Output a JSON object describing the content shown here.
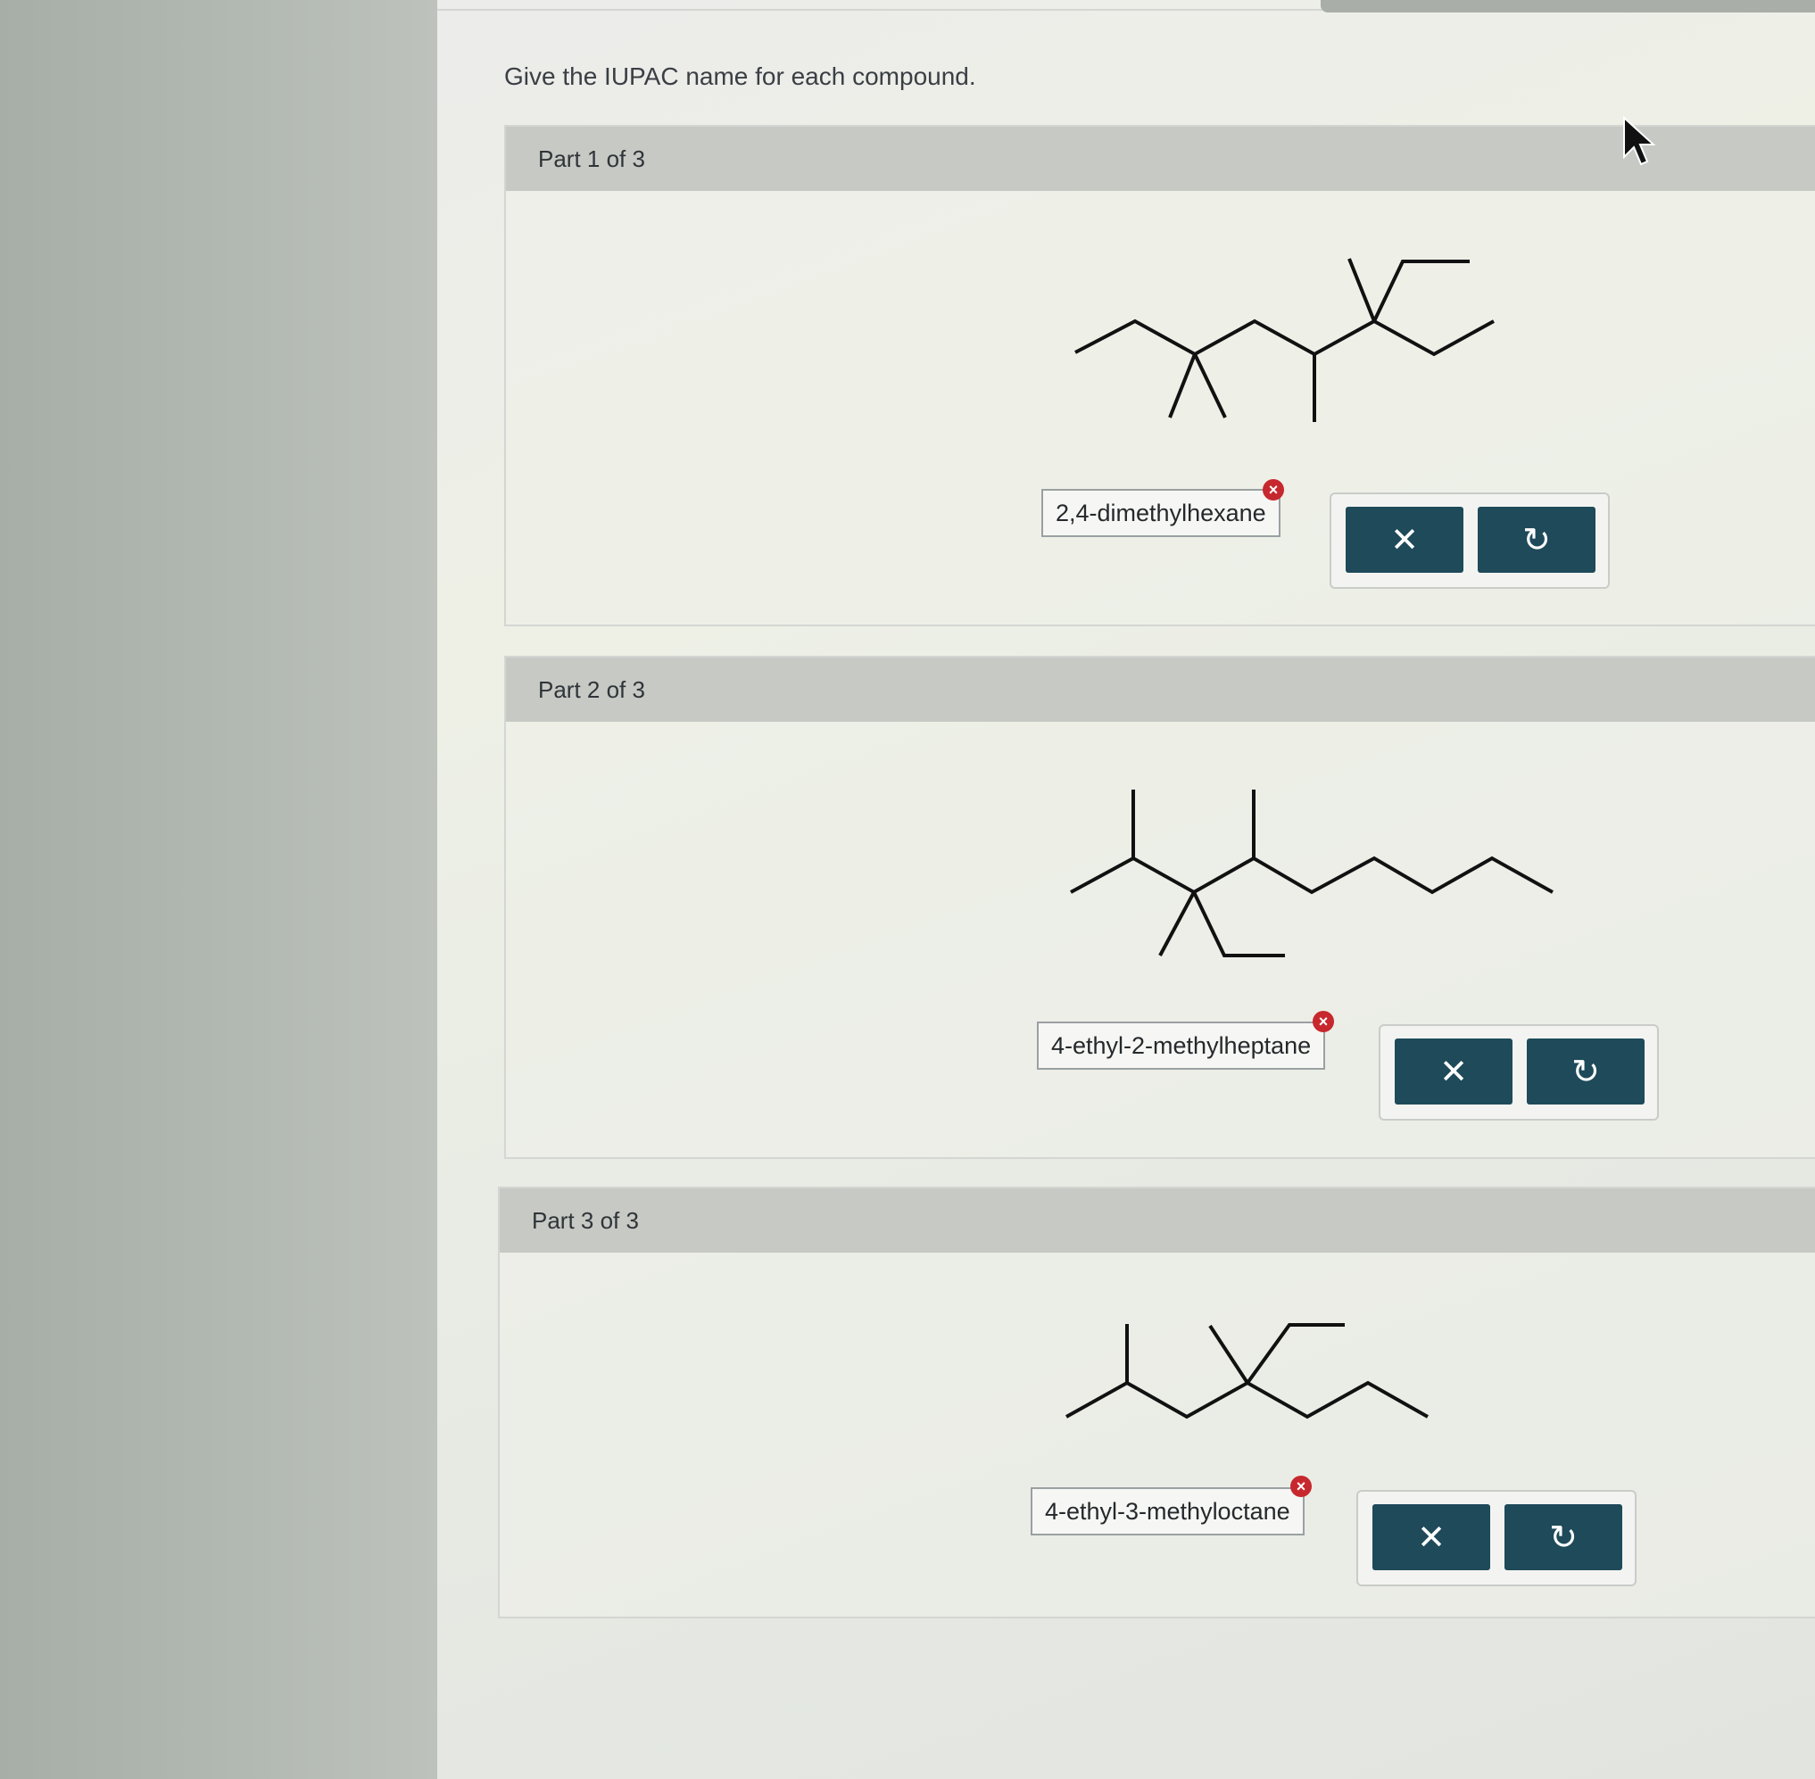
{
  "instructions": "Give the IUPAC name for each compound.",
  "parts": [
    {
      "header": "Part 1 of 3",
      "answer": "2,4-dimethylhexane",
      "status": "incorrect",
      "clear_icon": "✕",
      "undo_icon": "↻"
    },
    {
      "header": "Part 2 of 3",
      "answer": "4-ethyl-2-methylheptane",
      "status": "incorrect",
      "clear_icon": "✕",
      "undo_icon": "↻"
    },
    {
      "header": "Part 3 of 3",
      "answer": "4-ethyl-3-methyloctane",
      "status": "incorrect",
      "clear_icon": "✕",
      "undo_icon": "↻"
    }
  ],
  "error_badge": "×",
  "colors": {
    "button": "#1e4a5a",
    "error": "#c6282e",
    "header": "#c6c9c4"
  }
}
